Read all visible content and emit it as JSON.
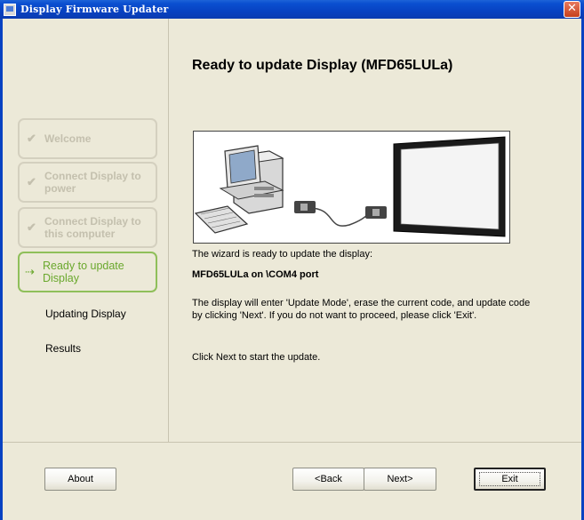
{
  "window": {
    "title": "Display Firmware Updater",
    "close_glyph": "✕"
  },
  "sidebar": {
    "steps": [
      {
        "label": "Welcome",
        "state": "done"
      },
      {
        "label": "Connect Display to power",
        "state": "done"
      },
      {
        "label": "Connect Display to this computer",
        "state": "done"
      },
      {
        "label": "Ready to update Display",
        "state": "active"
      },
      {
        "label": "Updating Display",
        "state": "pending"
      },
      {
        "label": "Results",
        "state": "pending"
      }
    ],
    "check_glyph": "✔",
    "arrow_glyph": "⇢"
  },
  "main": {
    "heading": "Ready to update Display (MFD65LULa)",
    "ready_text": "The wizard is ready to update the display:",
    "port_text": "MFD65LULa on \\COM4 port",
    "info_text": "The display will enter 'Update Mode', erase the current code, and update code by clicking 'Next'. If you do not want to proceed, please click 'Exit'.",
    "start_text": "Click Next to start the update."
  },
  "buttons": {
    "about": "About",
    "back": "<Back",
    "next": "Next>",
    "exit": "Exit"
  },
  "colors": {
    "titlebar": "#0a4fd0",
    "active_step": "#6aa82d",
    "disabled_step": "#c4c0ae",
    "dialog_bg": "#ece9d8"
  }
}
